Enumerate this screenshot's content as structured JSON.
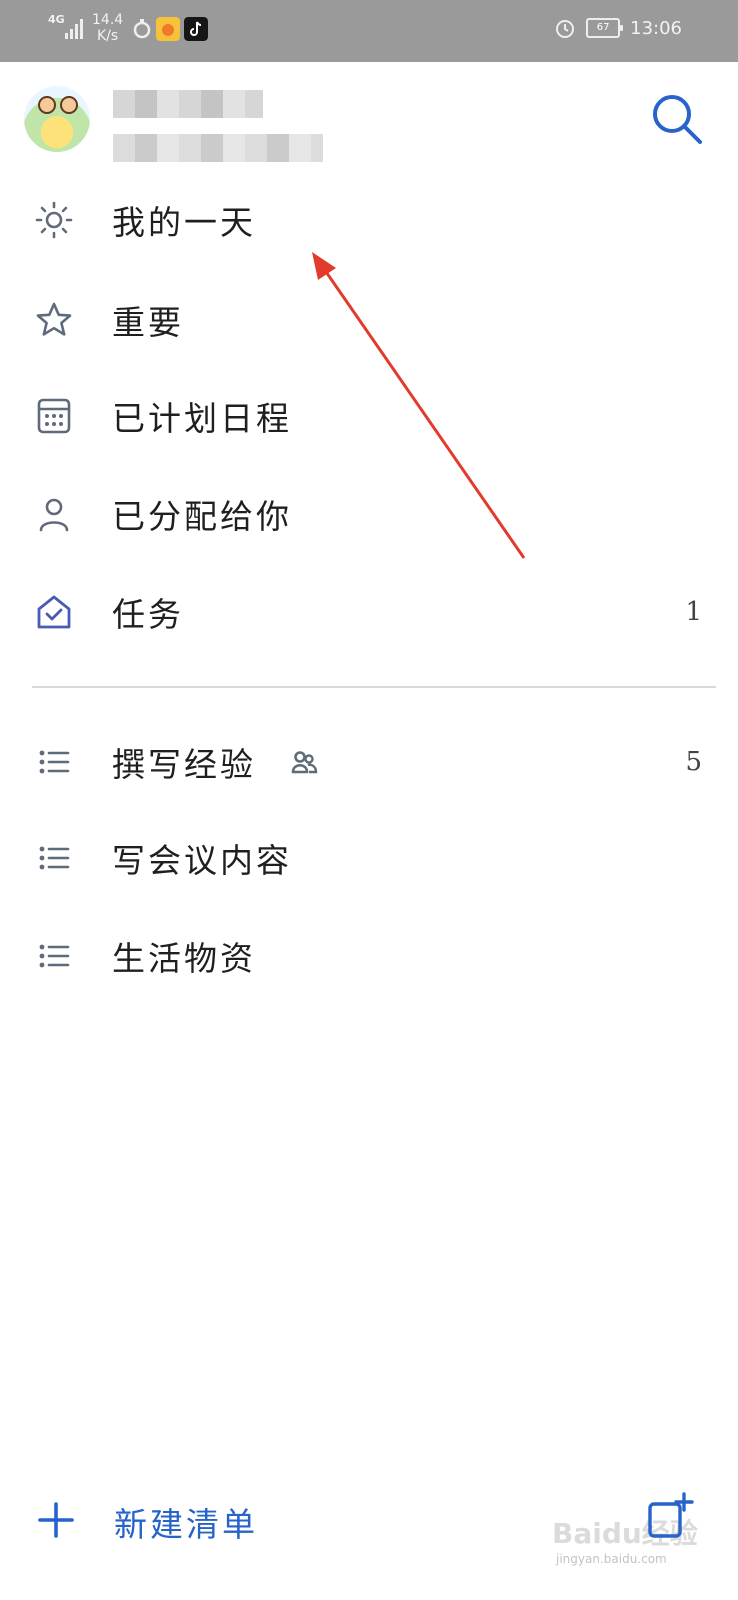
{
  "status_bar": {
    "network": "4G",
    "speed_value": "14.4",
    "speed_unit": "K/s",
    "battery": "67",
    "time": "13:06"
  },
  "account": {
    "name": "",
    "email": ""
  },
  "menu": {
    "items": [
      {
        "label": "我的一天",
        "icon": "sun-icon"
      },
      {
        "label": "重要",
        "icon": "star-icon"
      },
      {
        "label": "已计划日程",
        "icon": "calendar-icon"
      },
      {
        "label": "已分配给你",
        "icon": "person-icon"
      },
      {
        "label": "任务",
        "icon": "home-check-icon",
        "count": "1"
      }
    ]
  },
  "lists": {
    "items": [
      {
        "label": "撰写经验",
        "icon": "list-icon",
        "shared_icon": "shared-people-icon",
        "count": "5"
      },
      {
        "label": "写会议内容",
        "icon": "list-icon"
      },
      {
        "label": "生活物资",
        "icon": "list-icon"
      }
    ]
  },
  "footer": {
    "new_list_label": "新建清单",
    "watermark": "Baidu经验",
    "watermark_sub": "jingyan.baidu.com"
  },
  "colors": {
    "accent": "#2763c9",
    "icon_gray": "#5f6b7a",
    "task_icon": "#4a5bb3",
    "annotation_red": "#e23a2c"
  }
}
